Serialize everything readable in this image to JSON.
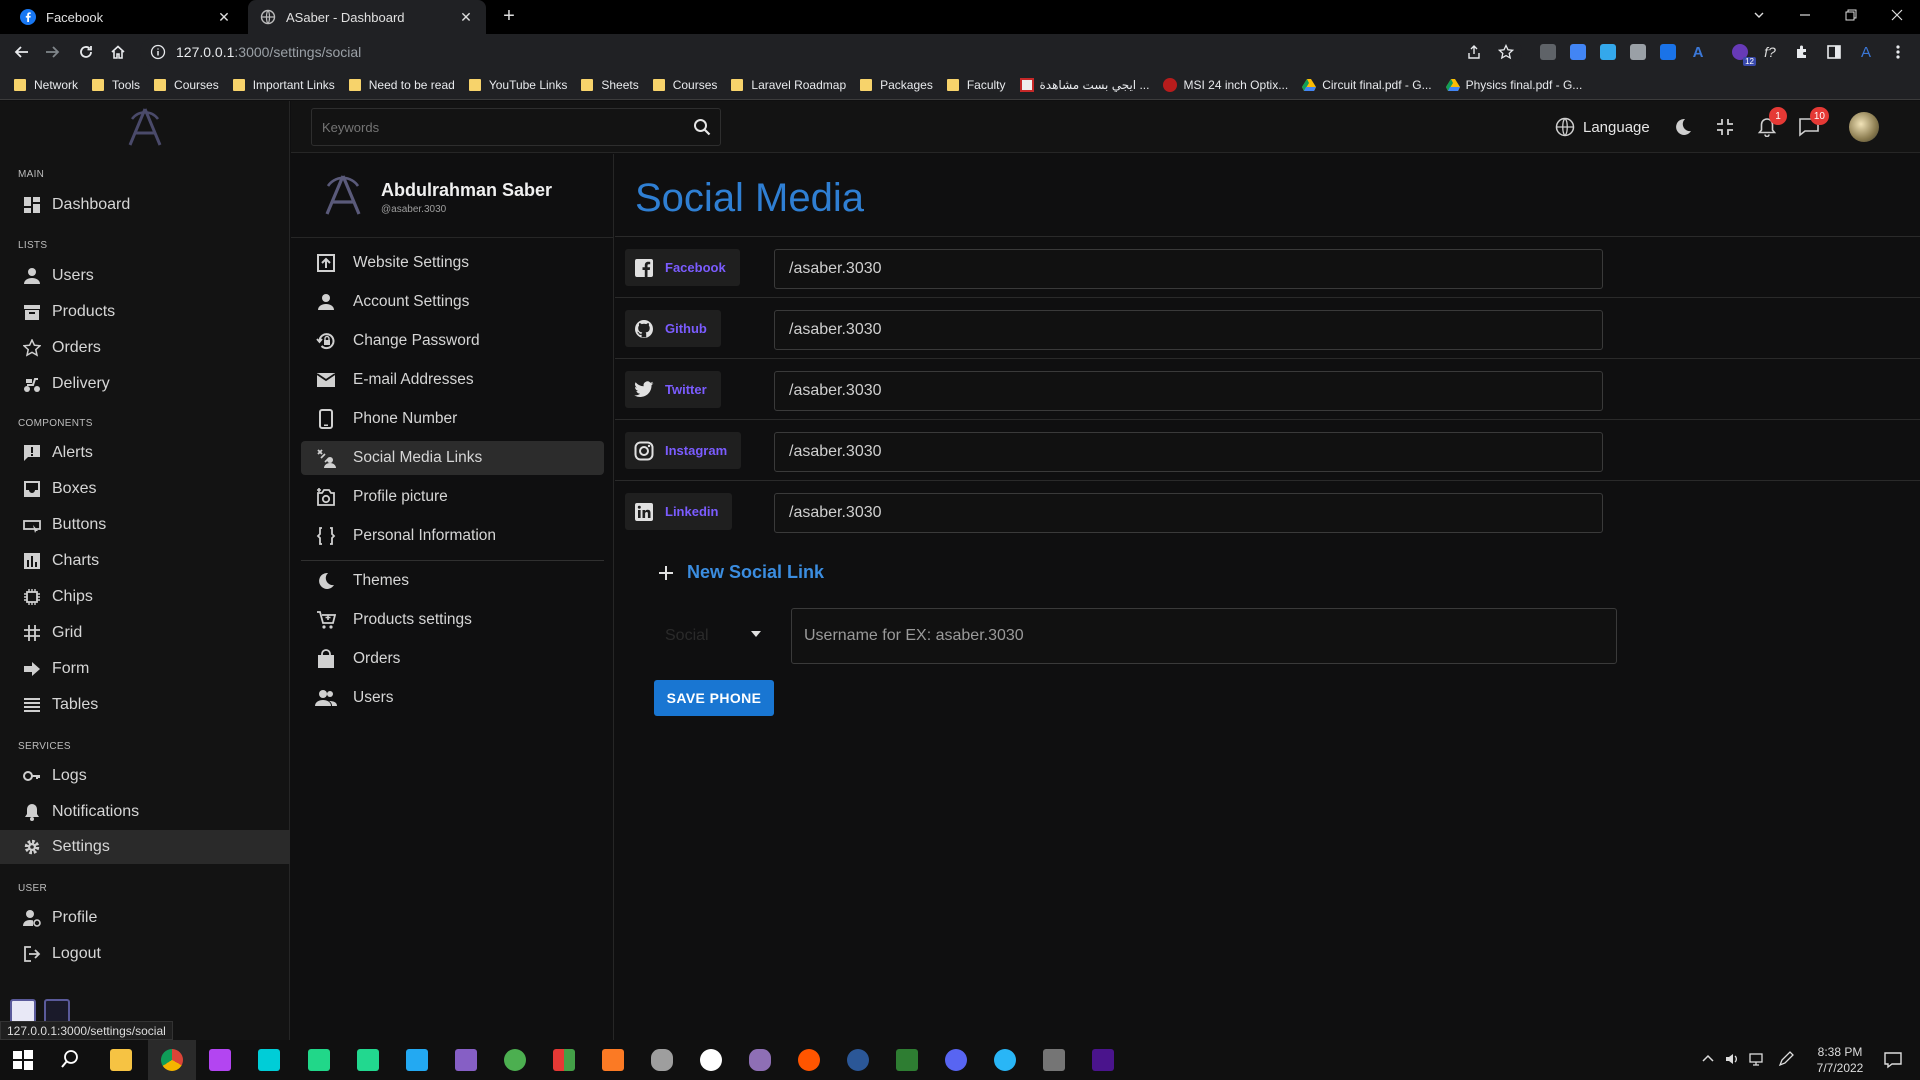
{
  "browser": {
    "tabs": [
      {
        "title": "Facebook"
      },
      {
        "title": "ASaber - Dashboard"
      }
    ],
    "url_host": "127.0.0.1",
    "url_path": ":3000/settings/social",
    "status_url": "127.0.0.1:3000/settings/social",
    "extension_badge": "12",
    "bookmarks": [
      {
        "label": "Network",
        "type": "folder"
      },
      {
        "label": "Tools",
        "type": "folder"
      },
      {
        "label": "Courses",
        "type": "folder"
      },
      {
        "label": "Important Links",
        "type": "folder"
      },
      {
        "label": "Need to be read",
        "type": "folder"
      },
      {
        "label": "YouTube Links",
        "type": "folder"
      },
      {
        "label": "Sheets",
        "type": "folder"
      },
      {
        "label": "Courses",
        "type": "folder"
      },
      {
        "label": "Laravel Roadmap",
        "type": "folder"
      },
      {
        "label": "Packages",
        "type": "folder"
      },
      {
        "label": "Faculty",
        "type": "folder"
      },
      {
        "label": "ايجي بست مشاهدة ...",
        "type": "site"
      },
      {
        "label": "MSI 24 inch Optix...",
        "type": "site"
      },
      {
        "label": "Circuit final.pdf - G...",
        "type": "drive"
      },
      {
        "label": "Physics final.pdf - G...",
        "type": "drive"
      }
    ]
  },
  "sidebar": {
    "sections": {
      "main": "MAIN",
      "lists": "LISTS",
      "components": "COMPONENTS",
      "services": "SERVICES",
      "user": "USER"
    },
    "items": {
      "dashboard": "Dashboard",
      "users": "Users",
      "products": "Products",
      "orders": "Orders",
      "delivery": "Delivery",
      "alerts": "Alerts",
      "boxes": "Boxes",
      "buttons": "Buttons",
      "charts": "Charts",
      "chips": "Chips",
      "grid": "Grid",
      "form": "Form",
      "tables": "Tables",
      "logs": "Logs",
      "notifications": "Notifications",
      "settings": "Settings",
      "profile": "Profile",
      "logout": "Logout"
    }
  },
  "header": {
    "search_placeholder": "Keywords",
    "language_label": "Language",
    "notifications_count": "1",
    "messages_count": "10"
  },
  "profile": {
    "name": "Abdulrahman Saber",
    "username": "@asaber.3030"
  },
  "settings_nav": {
    "website": "Website Settings",
    "account": "Account Settings",
    "password": "Change Password",
    "email": "E-mail Addresses",
    "phone": "Phone Number",
    "social": "Social Media Links",
    "picture": "Profile picture",
    "personal": "Personal Information",
    "themes": "Themes",
    "products": "Products settings",
    "orders": "Orders",
    "users": "Users"
  },
  "content": {
    "title": "Social Media",
    "links": [
      {
        "name": "Facebook",
        "value": "/asaber.3030"
      },
      {
        "name": "Github",
        "value": "/asaber.3030"
      },
      {
        "name": "Twitter",
        "value": "/asaber.3030"
      },
      {
        "name": "Instagram",
        "value": "/asaber.3030"
      },
      {
        "name": "Linkedin",
        "value": "/asaber.3030"
      }
    ],
    "new_link_label": "New Social Link",
    "select_placeholder": "Social",
    "new_input_placeholder": "Username for EX: asaber.3030",
    "save_button": "SAVE PHONE"
  },
  "taskbar": {
    "time": "8:38 PM",
    "date": "7/7/2022"
  },
  "colors": {
    "accent_blue": "#2f7fd3",
    "chip_purple": "#7b5cff",
    "button_blue": "#1976d2",
    "badge_red": "#e53935"
  }
}
